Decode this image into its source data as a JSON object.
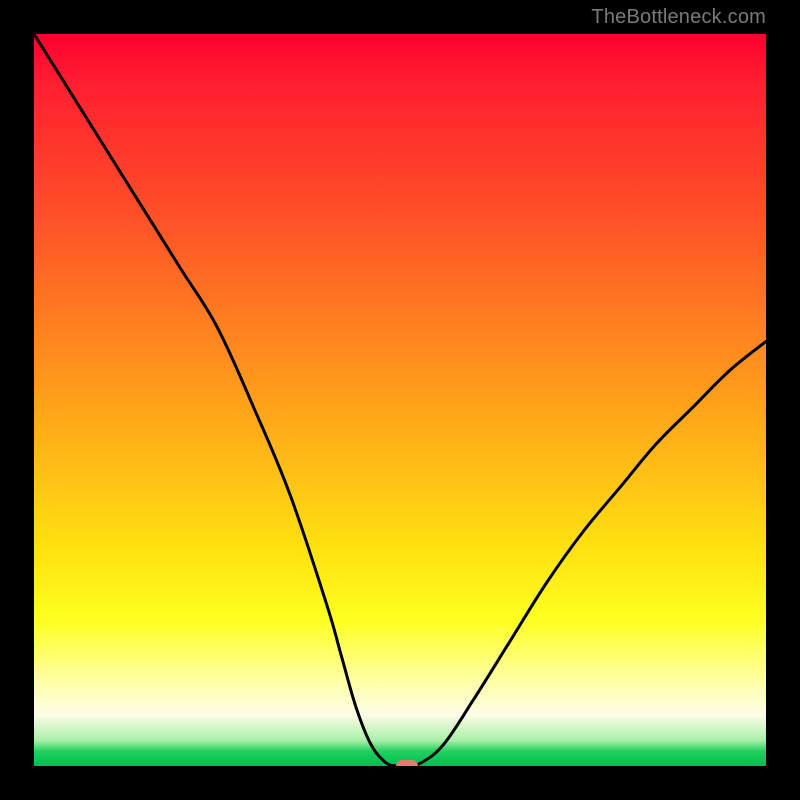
{
  "watermark": "TheBottleneck.com",
  "chart_data": {
    "type": "line",
    "title": "",
    "xlabel": "",
    "ylabel": "",
    "xlim": [
      0,
      100
    ],
    "ylim": [
      0,
      100
    ],
    "x": [
      0,
      5,
      10,
      15,
      20,
      25,
      30,
      35,
      40,
      42,
      44,
      46,
      48,
      49.5,
      51,
      53,
      56,
      60,
      65,
      70,
      75,
      80,
      85,
      90,
      95,
      100
    ],
    "y": [
      100,
      92,
      84,
      76,
      68,
      60,
      49,
      37,
      22,
      15,
      8,
      3,
      0.5,
      0,
      0,
      0.5,
      3,
      9,
      17,
      25,
      32,
      38,
      44,
      49,
      54,
      58
    ],
    "min_x": 50,
    "min_y": 0,
    "background": "red-yellow-green vertical gradient",
    "marker": {
      "x": 51,
      "y": 0
    }
  }
}
